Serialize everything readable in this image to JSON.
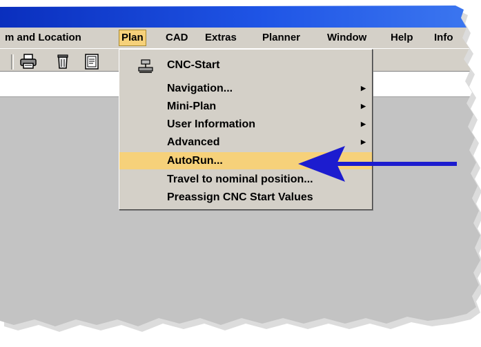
{
  "menubar": {
    "items": [
      {
        "label": "m and Location"
      },
      {
        "label": "Plan"
      },
      {
        "label": "CAD"
      },
      {
        "label": "Extras"
      },
      {
        "label": "Planner"
      },
      {
        "label": "Window"
      },
      {
        "label": "Help"
      },
      {
        "label": "Info"
      }
    ],
    "active_item": "Plan"
  },
  "toolbar": {
    "icons": [
      "printer-icon",
      "trash-icon",
      "document-icon"
    ]
  },
  "plan_menu": {
    "items": [
      {
        "label": "CNC-Start",
        "icon": "cnc-machine-icon"
      },
      {
        "label": "Navigation...",
        "submenu": true
      },
      {
        "label": "Mini-Plan",
        "submenu": true
      },
      {
        "label": "User Information",
        "submenu": true
      },
      {
        "label": "Advanced",
        "submenu": true
      },
      {
        "label": "AutoRun...",
        "highlighted": true
      },
      {
        "label": "Travel to nominal position..."
      },
      {
        "label": "Preassign CNC Start Values"
      }
    ]
  },
  "colors": {
    "titlebar": "#1f55e6",
    "highlight": "#f6d17a",
    "arrow": "#1c1ccf",
    "menu_bg": "#d4d0c8",
    "workspace": "#c3c3c3"
  }
}
